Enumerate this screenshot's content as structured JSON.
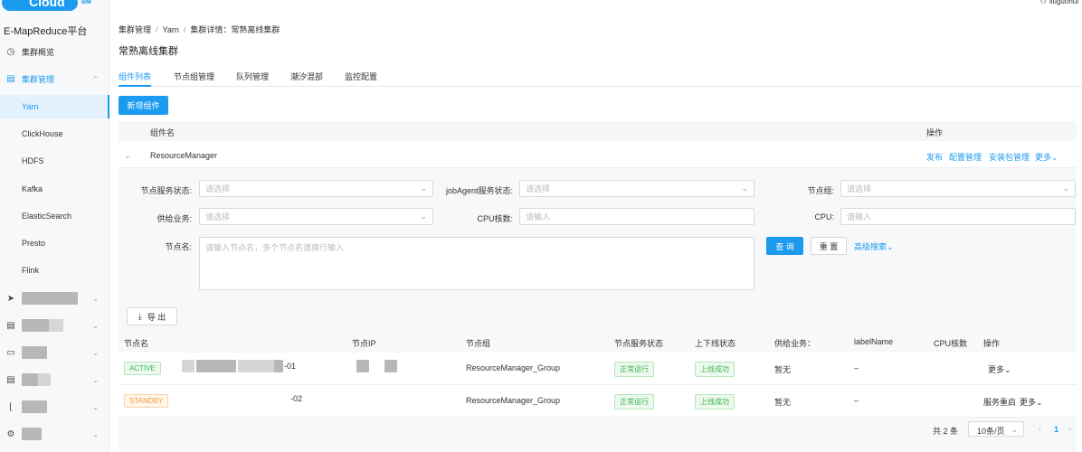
{
  "app": {
    "logo_text": "Cloud",
    "logo_suffix": "BM",
    "platform": "E-MapReduce平台",
    "user": "liuguohui"
  },
  "sidebar": {
    "items": [
      {
        "label": "集群概览",
        "icon": "clock-icon"
      },
      {
        "label": "集群管理",
        "icon": "document-icon"
      }
    ],
    "sub_items": [
      "Yarn",
      "ClickHouse",
      "HDFS",
      "Kafka",
      "ElasticSearch",
      "Presto",
      "Flink"
    ],
    "selected_sub": "Yarn"
  },
  "breadcrumb": [
    "集群管理",
    "Yarn",
    "集群详情：常熟离线集群"
  ],
  "page_title": "常熟离线集群",
  "tabs": [
    "组件列表",
    "节点组管理",
    "队列管理",
    "潮汐混部",
    "监控配置"
  ],
  "add_component_label": "新增组件",
  "component_table": {
    "headers": {
      "name": "组件名",
      "ops": "操作"
    },
    "row": {
      "name": "ResourceManager",
      "ops": [
        "发布",
        "配置管理",
        "安装包管理",
        "更多"
      ]
    }
  },
  "filters": {
    "node_service_status": {
      "label": "节点服务状态:",
      "placeholder": "请选择"
    },
    "jobagent_status": {
      "label": "jobAgent服务状态:",
      "placeholder": "请选择"
    },
    "node_group": {
      "label": "节点组:",
      "placeholder": "请选择"
    },
    "supply_business": {
      "label": "供给业务:",
      "placeholder": "请选择"
    },
    "cpu_cores": {
      "label": "CPU核数:",
      "placeholder": "请输入"
    },
    "cpu": {
      "label": "CPU:",
      "placeholder": "请输入"
    },
    "node_name": {
      "label": "节点名:",
      "placeholder": "请输入节点名，多个节点名请换行输入"
    },
    "search_label": "查 询",
    "reset_label": "重 置",
    "advanced_label": "高级搜索"
  },
  "export_label": "导 出",
  "node_table": {
    "headers": [
      "节点名",
      "节点IP",
      "节点组",
      "节点服务状态",
      "上下线状态",
      "供给业务：",
      "labelName",
      "CPU核数",
      "操作"
    ],
    "rows": [
      {
        "role": "ACTIVE",
        "name_suffix": "-01",
        "group": "ResourceManager_Group",
        "service_status": "正常运行",
        "online_status": "上线成功",
        "supply": "暂无",
        "label": "–",
        "ops": [
          "更多"
        ]
      },
      {
        "role": "STANDBY",
        "name_suffix": "-02",
        "group": "ResourceManager_Group",
        "service_status": "正常运行",
        "online_status": "上线成功",
        "supply": "暂无",
        "label": "–",
        "ops": [
          "服务重启",
          "更多"
        ]
      }
    ]
  },
  "pagination": {
    "total": "共 2 条",
    "page_size": "10条/页",
    "current_page": "1"
  },
  "colors": {
    "accent": "#1b9af0",
    "success": "#3bb54a",
    "warning": "#f39a38"
  }
}
